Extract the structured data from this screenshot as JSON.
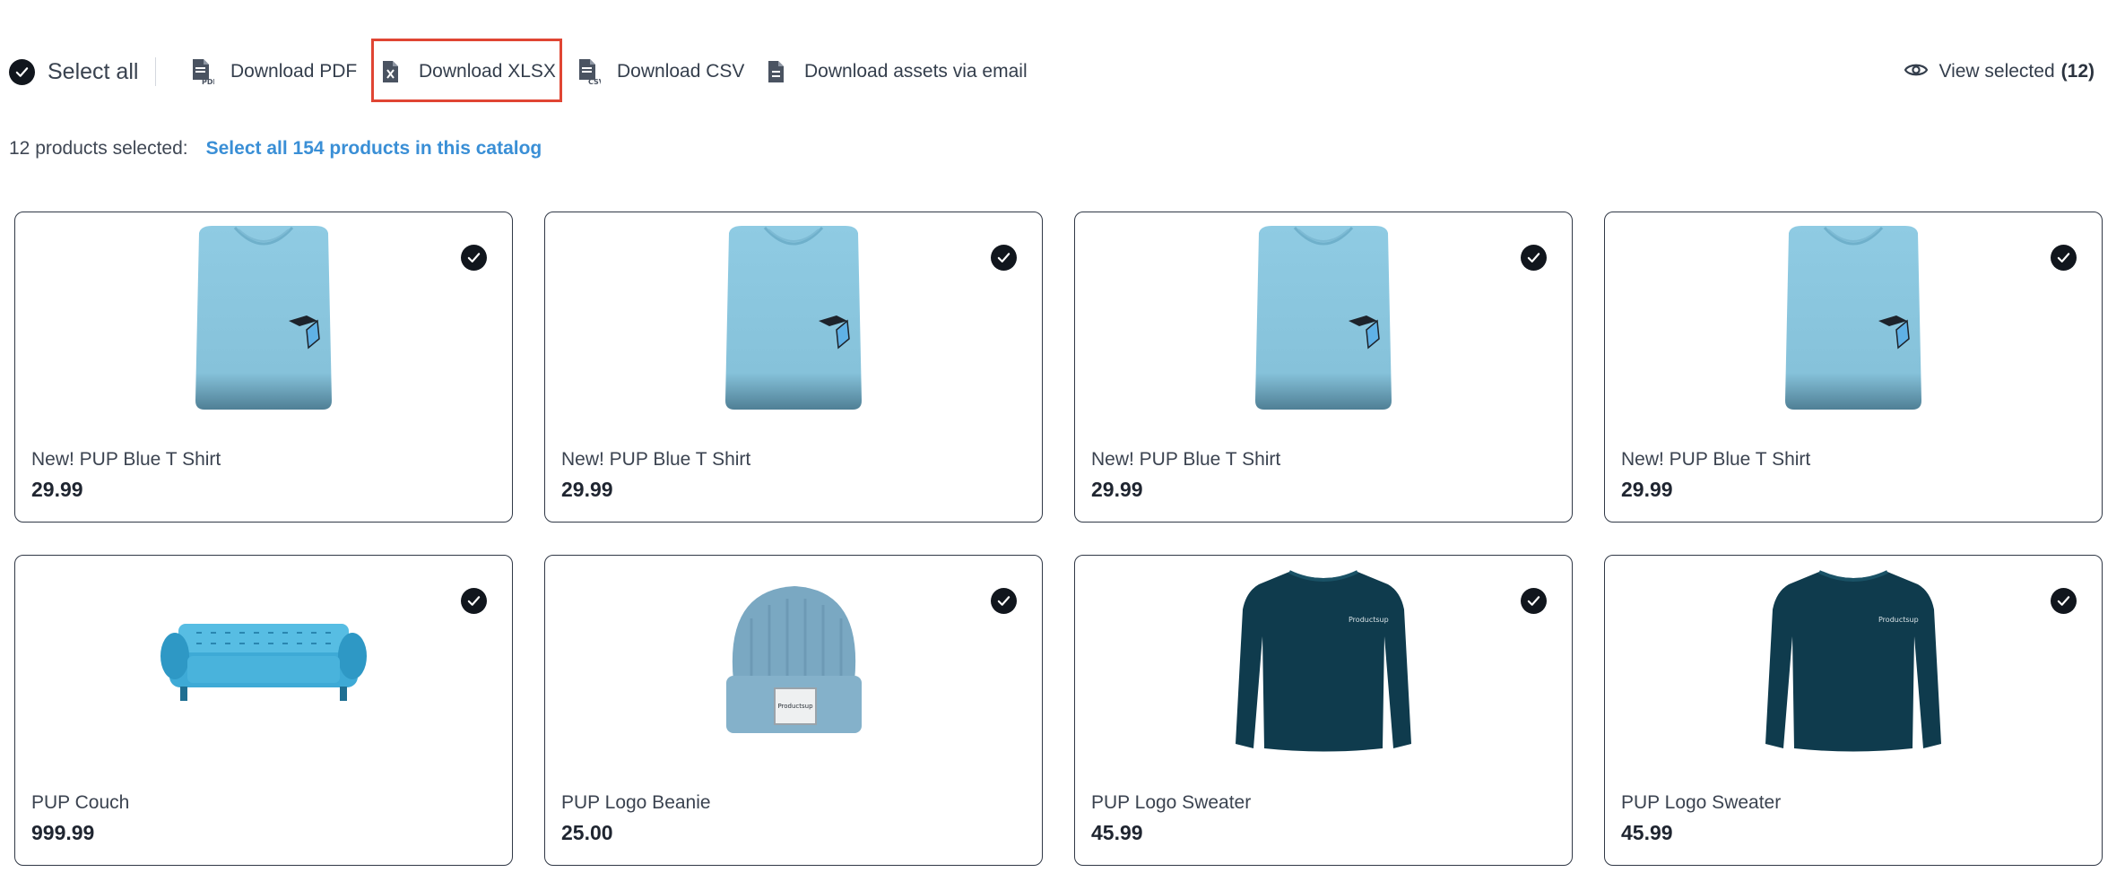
{
  "toolbar": {
    "select_all": "Select all",
    "download_pdf": "Download PDF",
    "download_xlsx": "Download XLSX",
    "download_csv": "Download CSV",
    "download_email": "Download assets via email",
    "view_selected": "View selected",
    "view_selected_count": "(12)",
    "icons": {
      "pdf": "pdf-file-icon",
      "xlsx": "xlsx-file-icon",
      "csv": "csv-file-icon",
      "email": "document-icon",
      "view": "eye-icon",
      "check": "check-circle-icon"
    }
  },
  "selection": {
    "summary": "12 products selected:",
    "select_all_link": "Select all 154 products in this catalog"
  },
  "products": [
    {
      "name": "New! PUP Blue T Shirt",
      "price": "29.99",
      "image": "tshirt"
    },
    {
      "name": "New! PUP Blue T Shirt",
      "price": "29.99",
      "image": "tshirt"
    },
    {
      "name": "New! PUP Blue T Shirt",
      "price": "29.99",
      "image": "tshirt"
    },
    {
      "name": "New! PUP Blue T Shirt",
      "price": "29.99",
      "image": "tshirt"
    },
    {
      "name": "PUP Couch",
      "price": "999.99",
      "image": "couch"
    },
    {
      "name": "PUP Logo Beanie",
      "price": "25.00",
      "image": "beanie"
    },
    {
      "name": "PUP Logo Sweater",
      "price": "45.99",
      "image": "sweater"
    },
    {
      "name": "PUP Logo Sweater",
      "price": "45.99",
      "image": "sweater"
    }
  ],
  "colors": {
    "accent_link": "#3a8fd6",
    "highlight": "#e04533",
    "check": "#11161d"
  }
}
